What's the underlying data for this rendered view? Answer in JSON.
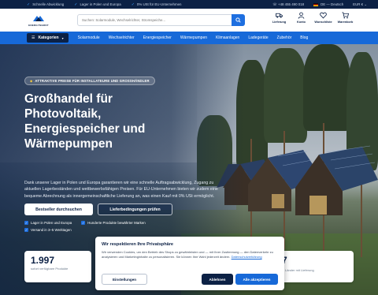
{
  "topbar": {
    "usps": [
      "Schnelle Abwicklung",
      "Lager in Polen und Europa",
      "0% USt für EU-Unternehmen"
    ],
    "phone": "+48 455 490 018",
    "language": "DE — Deutsch",
    "currency": "EUR €"
  },
  "header": {
    "logo_text": "ENERGYMARKT",
    "search_placeholder": "Suchen: Solarmodule, Wechselrichter, Stromspeiche...",
    "icons": [
      {
        "label": "Lieferung",
        "icon": "truck-icon"
      },
      {
        "label": "Konto",
        "icon": "user-icon"
      },
      {
        "label": "Wunschliste",
        "icon": "heart-icon"
      },
      {
        "label": "Warenkorb",
        "icon": "cart-icon"
      }
    ]
  },
  "nav": {
    "categories_label": "Kategorien",
    "items": [
      "Solarmodule",
      "Wechselrichter",
      "Energiespeicher",
      "Wärmepumpen",
      "Klimaanlagen",
      "Ladegeräte",
      "Zubehör",
      "Blog"
    ]
  },
  "hero": {
    "badge": "ATTRAKTIVE PREISE FÜR INSTALLATEURE UND GROSSHÄNDLER",
    "title": "Großhandel für Photovoltaik, Energiespeicher und Wärmepumpen",
    "subtitle": "Dank unserer Lager in Polen und Europa garantieren wir eine schnelle Auftragsabwicklung, Zugang zu aktuellen Lagerbeständen und wettbewerbsfähigen Preisen. Für EU-Unternehmen bieten wir zudem eine bequeme Abrechnung als innergemeinschaftliche Lieferung an, was einen Kauf mit 0% USt ermöglicht.",
    "cta_primary": "Bestseller durchsuchen",
    "cta_secondary": "Lieferbedingungen prüfen",
    "checks": [
      "Lager in Polen und Europa",
      "Hunderte Produkte bewährter Marken",
      "Versand in 3–5 Werktagen"
    ]
  },
  "stats": [
    {
      "number": "1.997",
      "label": "sofort verfügbare Produkte"
    },
    {
      "number": "7",
      "label": "Länder mit Lieferung"
    }
  ],
  "cookie": {
    "title": "Wir respektieren Ihre Privatsphäre",
    "body": "Wir verwenden Cookies, um den Betrieb des Shops zu gewährleisten und — mit Ihrer Zustimmung — den Datenverkehr zu analysieren und Marketinginhalte zu personalisieren. Sie können Ihre Wahl jederzeit ändern.",
    "link": "Datenschutzerklärung",
    "btn_settings": "Einstellungen",
    "btn_reject": "Ablehnen",
    "btn_accept": "Alle akzeptieren"
  },
  "colors": {
    "navy": "#0c2145",
    "primary_blue": "#1769d8",
    "search_blue": "#1e6fe0",
    "accent_yellow": "#ffcf3a"
  }
}
